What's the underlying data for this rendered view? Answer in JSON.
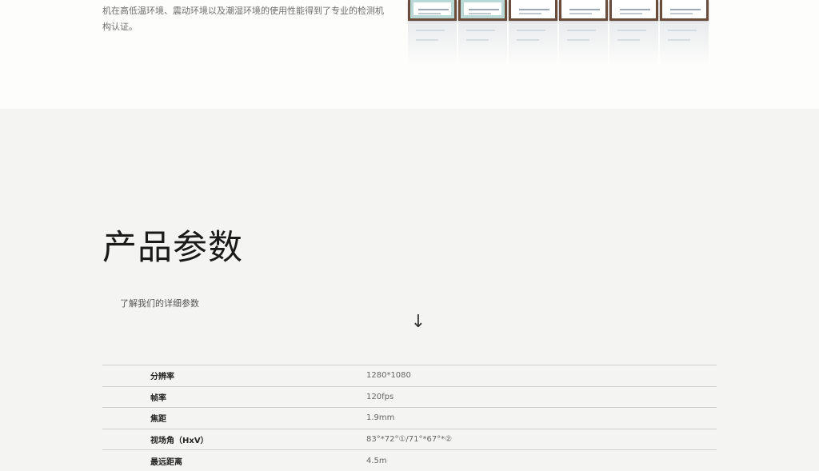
{
  "intro": {
    "text": "机在高低温环境、震动环境以及潮湿环境的使用性能得到了专业的检测机构认证。"
  },
  "certificates": [
    {
      "name": "certificate-1",
      "frame": "teal"
    },
    {
      "name": "certificate-2",
      "frame": "teal"
    },
    {
      "name": "certificate-3",
      "frame": "white"
    },
    {
      "name": "certificate-4",
      "frame": "white"
    },
    {
      "name": "certificate-5",
      "frame": "white"
    },
    {
      "name": "certificate-6",
      "frame": "white"
    }
  ],
  "params": {
    "title": "产品参数",
    "subtitle": "了解我们的详细参数",
    "arrow": "↓",
    "rows": [
      {
        "label": "分辨率",
        "value": "1280*1080"
      },
      {
        "label": "帧率",
        "value": "120fps"
      },
      {
        "label": "焦距",
        "value": "1.9mm"
      },
      {
        "label": "视场角（HxV）",
        "value": "83°*72°①/71°*67°*②"
      },
      {
        "label": "最远距离",
        "value": "4.5m"
      }
    ]
  },
  "colors": {
    "top_band": "#fdfdfb",
    "page_bg": "#f4f4f2",
    "frame_brown": "#6b4d3d",
    "frame_teal": "#b9d9d6"
  }
}
